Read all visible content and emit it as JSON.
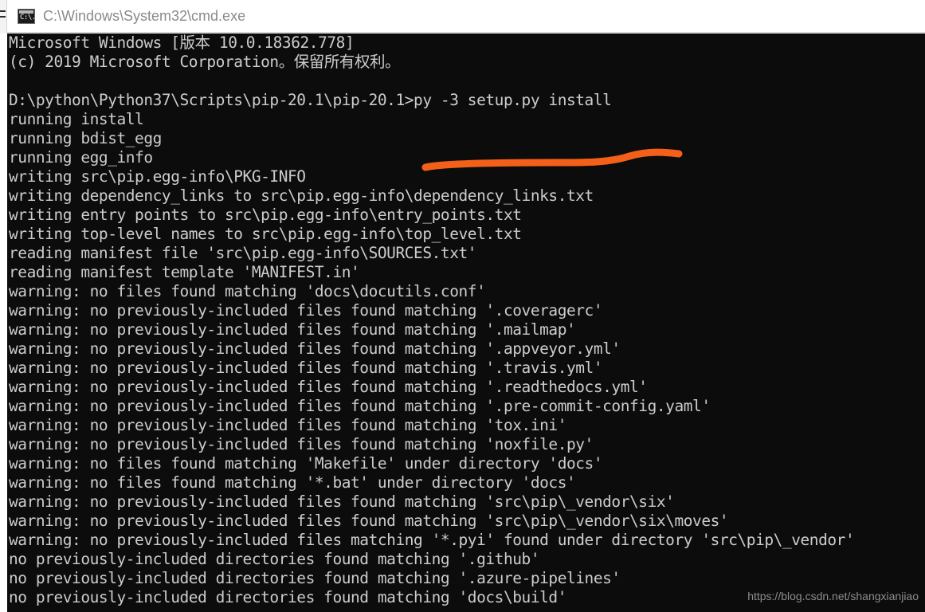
{
  "window": {
    "title": "C:\\Windows\\System32\\cmd.exe",
    "icon": "cmd-console-icon",
    "icon_glyph": "C:\\.",
    "colors": {
      "titlebar_bg": "#ffffff",
      "title_text": "#8a8a8a",
      "console_bg": "#0c0c0c",
      "console_text": "#cccccc",
      "annotation": "#f4601a",
      "watermark": "#8d8d8d"
    }
  },
  "console": {
    "lines": [
      "Microsoft Windows [版本 10.0.18362.778]",
      "(c) 2019 Microsoft Corporation。保留所有权利。",
      "",
      "D:\\python\\Python37\\Scripts\\pip-20.1\\pip-20.1>py -3 setup.py install",
      "running install",
      "running bdist_egg",
      "running egg_info",
      "writing src\\pip.egg-info\\PKG-INFO",
      "writing dependency_links to src\\pip.egg-info\\dependency_links.txt",
      "writing entry points to src\\pip.egg-info\\entry_points.txt",
      "writing top-level names to src\\pip.egg-info\\top_level.txt",
      "reading manifest file 'src\\pip.egg-info\\SOURCES.txt'",
      "reading manifest template 'MANIFEST.in'",
      "warning: no files found matching 'docs\\docutils.conf'",
      "warning: no previously-included files found matching '.coveragerc'",
      "warning: no previously-included files found matching '.mailmap'",
      "warning: no previously-included files found matching '.appveyor.yml'",
      "warning: no previously-included files found matching '.travis.yml'",
      "warning: no previously-included files found matching '.readthedocs.yml'",
      "warning: no previously-included files found matching '.pre-commit-config.yaml'",
      "warning: no previously-included files found matching 'tox.ini'",
      "warning: no previously-included files found matching 'noxfile.py'",
      "warning: no files found matching 'Makefile' under directory 'docs'",
      "warning: no files found matching '*.bat' under directory 'docs'",
      "warning: no previously-included files found matching 'src\\pip\\_vendor\\six'",
      "warning: no previously-included files found matching 'src\\pip\\_vendor\\six\\moves'",
      "warning: no previously-included files matching '*.pyi' found under directory 'src\\pip\\_vendor'",
      "no previously-included directories found matching '.github'",
      "no previously-included directories found matching '.azure-pipelines'",
      "no previously-included directories found matching 'docs\\build'"
    ]
  },
  "annotation": {
    "type": "hand-drawn-underline",
    "color": "#f4601a",
    "target_text": "py -3 setup.py install"
  },
  "watermark": {
    "text": "https://blog.csdn.net/shangxianjiao"
  }
}
